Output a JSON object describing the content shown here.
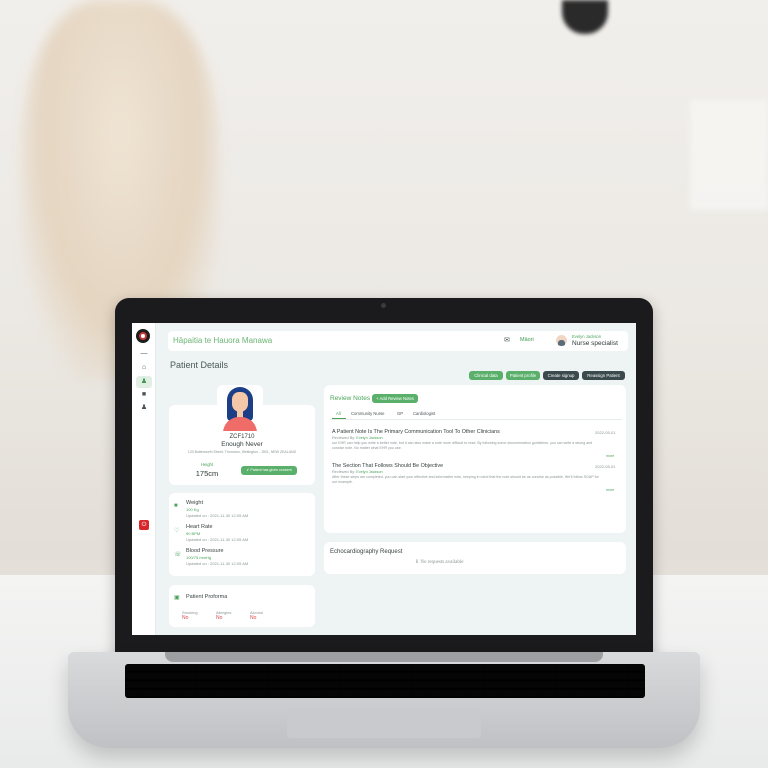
{
  "app": {
    "brand": "Hāpaitia te Hauora Manawa",
    "language_toggle": "Māori"
  },
  "user": {
    "name": "Evelyn Jackson",
    "role": "Nurse specialist"
  },
  "page": {
    "title": "Patient Details"
  },
  "actions": {
    "clinical_data": "Clinical data",
    "patient_profile": "Patient profile",
    "create_signup": "Create signup",
    "reassign_patient": "Reassign Patient"
  },
  "patient": {
    "id": "ZCF1710",
    "name": "Enough Never",
    "address": "120 Butterworth Street, Thorndon, Wellington - 1501, NEW ZEALAND",
    "height_label": "Height",
    "height_value": "175cm",
    "consent_label": "Patient has given consent"
  },
  "vitals": [
    {
      "title": "Weight",
      "value": "100 Kg",
      "updated": "Updated on : 2021-11-30 12:05 AM",
      "icon": "scale-icon"
    },
    {
      "title": "Heart Rate",
      "value": "90 BPM",
      "updated": "Updated on : 2021-11-30 12:05 AM",
      "icon": "heart-icon"
    },
    {
      "title": "Blood Pressure",
      "value": "100/75 mmHg",
      "updated": "Updated on : 2021-11-30 12:05 AM",
      "icon": "stethoscope-icon"
    }
  ],
  "proforma": {
    "title": "Patient Proforma",
    "items": [
      {
        "label": "Smoking",
        "value": "No"
      },
      {
        "label": "Allergies",
        "value": "No"
      },
      {
        "label": "Alcohol",
        "value": "No"
      }
    ]
  },
  "review_notes": {
    "title": "Review Notes",
    "add_label": "+ Add Review Notes",
    "tabs": [
      "All",
      "Community Nurse",
      "GP",
      "Cardiologist"
    ],
    "notes": [
      {
        "title": "A Patient Note Is The Primary Communication Tool To Other Clinicians",
        "date": "2022-05-01",
        "reviewed_prefix": "Reviewed By:",
        "reviewer": "Evelyn Jackson",
        "body": "our EHR can help you write a better note, but it can also make a note more difficult to read. By following some documentation guidelines, you can write a strong and concise note. No matter what EHR you use.",
        "link": "more"
      },
      {
        "title": "The Section That Follows Should Be Objective",
        "date": "2022-05-01",
        "reviewed_prefix": "Reviewed By:",
        "reviewer": "Evelyn Jackson",
        "body": "After these steps are completed, you can start your effective and informative note, keeping in mind that the note should be as concise as possible. We'll follow SOAP for our example.",
        "link": "more"
      }
    ]
  },
  "echo": {
    "title": "Echocardiography Request",
    "empty": "No requests available"
  },
  "colors": {
    "accent": "#5ab06a",
    "dark_button": "#3b4a4d",
    "alert": "#d9262c"
  }
}
